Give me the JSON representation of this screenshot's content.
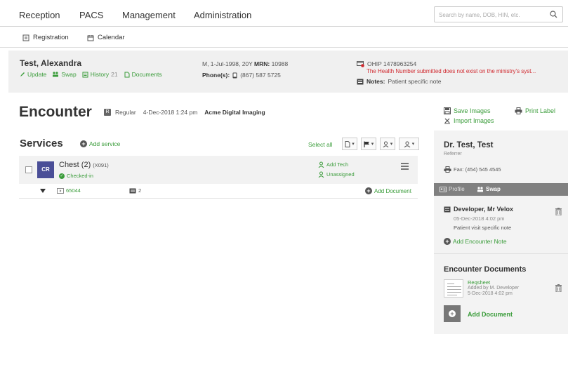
{
  "nav": {
    "items": [
      "Reception",
      "PACS",
      "Management",
      "Administration"
    ],
    "search_placeholder": "Search by name, DOB, HIN, etc."
  },
  "subnav": {
    "registration": "Registration",
    "calendar": "Calendar"
  },
  "patient": {
    "name": "Test, Alexandra",
    "update": "Update",
    "swap": "Swap",
    "history": "History",
    "history_count": "21",
    "documents": "Documents",
    "demographics_prefix": "M, 1-Jul-1998, 20Y",
    "mrn_label": "MRN:",
    "mrn": "10988",
    "phone_label": "Phone(s):",
    "phone": "(867) 587 5725",
    "ohip": "OHIP 1478963254",
    "ohip_message": "The Health Number submitted does not exist on the ministry's syst...",
    "notes_label": "Notes:",
    "notes": "Patient specific note"
  },
  "encounter": {
    "title": "Encounter",
    "type": "Regular",
    "datetime": "4-Dec-2018 1:24 pm",
    "facility": "Acme Digital Imaging",
    "save_images": "Save Images",
    "import_images": "Import Images",
    "print_label": "Print Label"
  },
  "services": {
    "title": "Services",
    "add_service": "Add service",
    "select_all": "Select all",
    "item": {
      "modality": "CR",
      "name": "Chest (2)",
      "code": "(X091)",
      "status": "Checked-in",
      "add_tech": "Add Tech",
      "unassigned": "Unassigned",
      "accession": "65044",
      "image_count": "2",
      "add_document": "Add Document"
    }
  },
  "panel": {
    "doctor": "Dr. Test, Test",
    "referrer_label": "Referrer",
    "fax": "Fax: (454) 545 4545",
    "tab_profile": "Profile",
    "tab_swap": "Swap",
    "note_author": "Developer, Mr Velox",
    "note_date": "05-Dec-2018 4:02 pm",
    "note_text": "Patient visit specific note",
    "add_encounter_note": "Add Encounter Note",
    "documents_title": "Encounter Documents",
    "doc_title": "Reqsheet",
    "doc_added_by": "Added by M. Developer",
    "doc_date": "5-Dec-2018 4:02 pm",
    "add_document": "Add Document"
  }
}
